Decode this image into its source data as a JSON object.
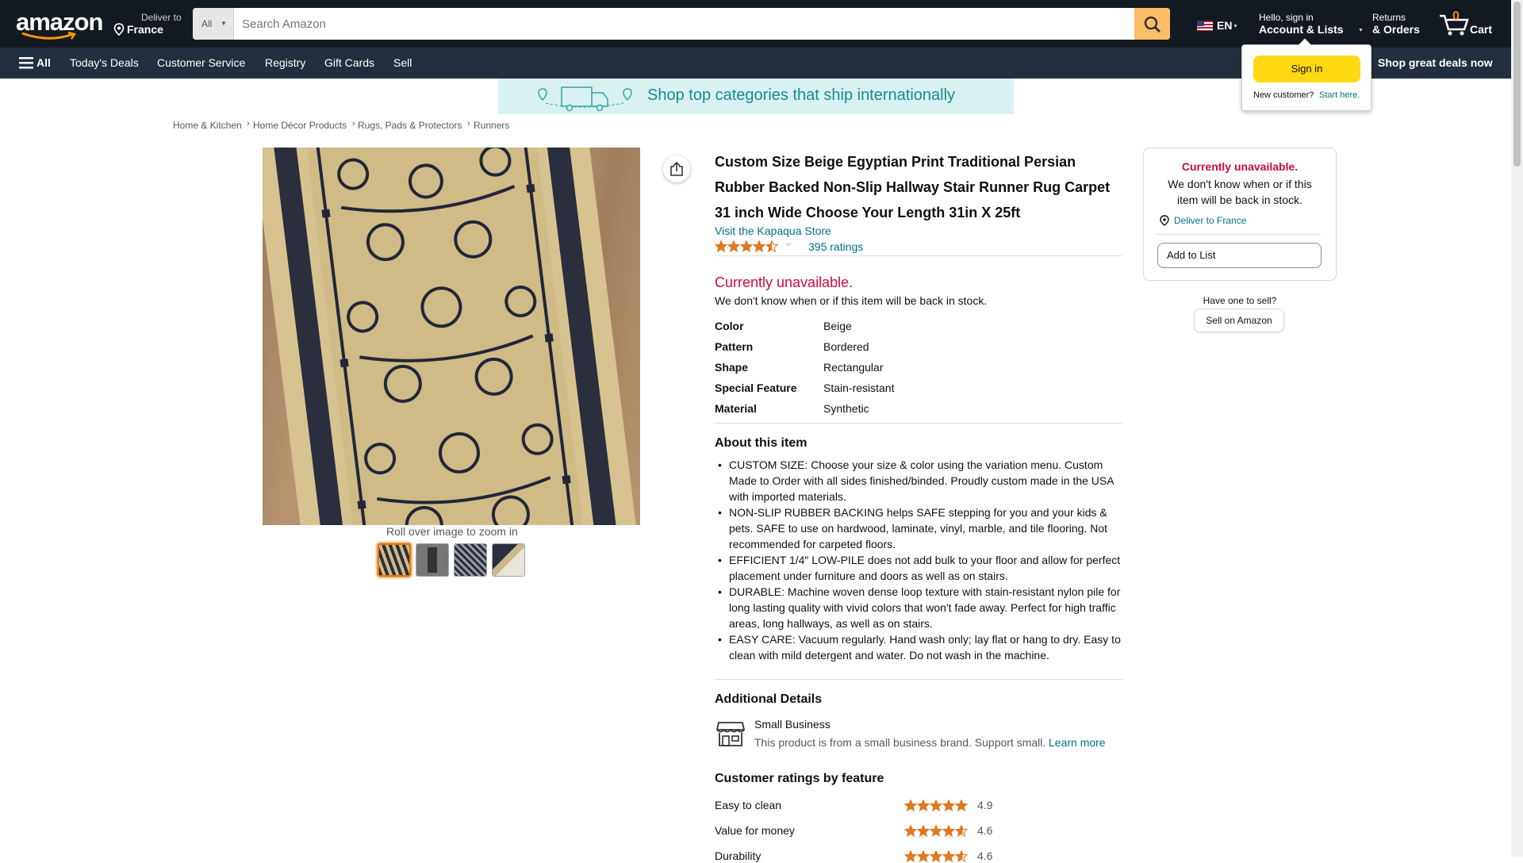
{
  "header": {
    "logo": "amazon",
    "deliver_label": "Deliver to",
    "deliver_location": "France",
    "search": {
      "category": "All",
      "placeholder": "Search Amazon"
    },
    "language": "EN",
    "account_greeting": "Hello, sign in",
    "account_label": "Account & Lists",
    "returns_label": "Returns",
    "orders_label": "& Orders",
    "cart_count": "0",
    "cart_label": "Cart"
  },
  "subnav": {
    "all_label": "All",
    "links": [
      "Today's Deals",
      "Customer Service",
      "Registry",
      "Gift Cards",
      "Sell"
    ],
    "promo": "Shop great deals now"
  },
  "signin_popover": {
    "button": "Sign in",
    "new_customer": "New customer?",
    "start_here": "Start here."
  },
  "banner": {
    "text": "Shop top categories that ship internationally"
  },
  "breadcrumb": [
    "Home & Kitchen",
    "Home Décor Products",
    "Rugs, Pads & Protectors",
    "Runners"
  ],
  "gallery": {
    "zoom_hint": "Roll over image to zoom in"
  },
  "product": {
    "title_lines": [
      "Custom Size Beige Egyptian Print Traditional Persian",
      "Rubber Backed Non-Slip Hallway Stair Runner Rug Carpet",
      "31 inch Wide Choose Your Length 31in X 25ft"
    ],
    "store_link": "Visit the Kapaqua Store",
    "star_rating": 4.5,
    "ratings_count": "395 ratings",
    "availability": "Currently unavailable.",
    "availability_note": "We don't know when or if this item will be back in stock.",
    "specs": [
      {
        "key": "Color",
        "value": "Beige"
      },
      {
        "key": "Pattern",
        "value": "Bordered"
      },
      {
        "key": "Shape",
        "value": "Rectangular"
      },
      {
        "key": "Special Feature",
        "value": "Stain-resistant"
      },
      {
        "key": "Material",
        "value": "Synthetic"
      }
    ],
    "about_heading": "About this item",
    "bullets": [
      [
        "CUSTOM SIZE: Choose your size & color using the variation menu. Custom",
        "Made to Order with all sides finished/binded. Proudly custom made in the USA",
        "with imported materials."
      ],
      [
        "NON-SLIP RUBBER BACKING helps SAFE stepping for you and your kids &",
        "pets. SAFE to use on hardwood, laminate, vinyl, marble, and tile flooring. Not",
        "recommended for carpeted floors."
      ],
      [
        "EFFICIENT 1/4\" LOW-PILE does not add bulk to your floor and allow for perfect",
        "placement under furniture and doors as well as on stairs."
      ],
      [
        "DURABLE: Machine woven dense loop texture with stain-resistant nylon pile for",
        "long lasting quality with vivid colors that won't fade away. Perfect for high traffic",
        "areas, long hallways, as well as on stairs."
      ],
      [
        "EASY CARE: Vacuum regularly. Hand wash only; lay flat or hang to dry. Easy to",
        "clean with mild detergent and water. Do not wash in the machine."
      ]
    ],
    "additional_heading": "Additional Details",
    "small_business_title": "Small Business",
    "small_business_text": "This product is from a small business brand. Support small.",
    "learn_more": "Learn more",
    "ratings_heading": "Customer ratings by feature",
    "feature_ratings": [
      {
        "label": "Easy to clean",
        "value": "4.9"
      },
      {
        "label": "Value for money",
        "value": "4.6"
      },
      {
        "label": "Durability",
        "value": "4.6"
      }
    ]
  },
  "buybox": {
    "status": "Currently unavailable.",
    "note_lines": [
      "We don't know when or if this",
      "item will be back in stock."
    ],
    "deliver": "Deliver to France",
    "add_to_list": "Add to List",
    "have_one": "Have one to sell?",
    "sell_button": "Sell on Amazon"
  },
  "colors": {
    "header": "#131921",
    "subnav": "#232f3e",
    "search_button": "#febd69",
    "signin": "#ffd814",
    "unavailable": "#cc0c39",
    "link": "#007185",
    "star": "#de7921"
  }
}
